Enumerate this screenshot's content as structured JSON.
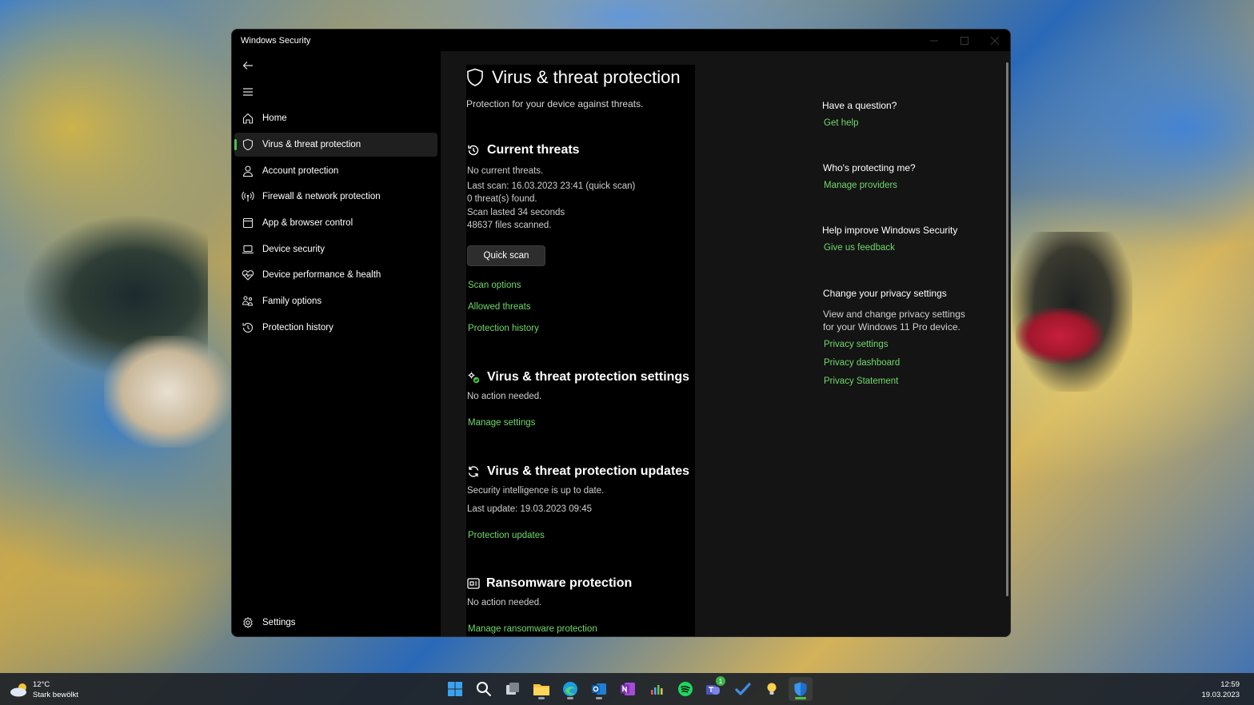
{
  "window": {
    "title": "Windows Security",
    "controls": [
      "minimize-icon",
      "maximize-icon",
      "close-icon"
    ]
  },
  "sidebar": {
    "back_icon": "back-arrow-icon",
    "menu_icon": "hamburger-icon",
    "items": [
      {
        "label": "Home",
        "icon": "home-icon",
        "active": false
      },
      {
        "label": "Virus & threat protection",
        "icon": "shield-icon",
        "active": true
      },
      {
        "label": "Account protection",
        "icon": "person-icon",
        "active": false
      },
      {
        "label": "Firewall & network protection",
        "icon": "antenna-icon",
        "active": false
      },
      {
        "label": "App & browser control",
        "icon": "app-window-icon",
        "active": false
      },
      {
        "label": "Device security",
        "icon": "laptop-icon",
        "active": false
      },
      {
        "label": "Device performance & health",
        "icon": "heart-pulse-icon",
        "active": false
      },
      {
        "label": "Family options",
        "icon": "family-icon",
        "active": false
      },
      {
        "label": "Protection history",
        "icon": "history-icon",
        "active": false
      }
    ],
    "settings_label": "Settings"
  },
  "main": {
    "title": "Virus & threat protection",
    "subtitle": "Protection for your device against threats.",
    "current_threats": {
      "heading": "Current threats",
      "lines": [
        "No current threats.",
        "Last scan: 16.03.2023 23:41 (quick scan)",
        "0 threat(s) found.",
        "Scan lasted 34 seconds",
        "48637 files scanned."
      ],
      "button": "Quick scan",
      "links": [
        "Scan options",
        "Allowed threats",
        "Protection history"
      ]
    },
    "settings_section": {
      "heading": "Virus & threat protection settings",
      "status": "No action needed.",
      "link": "Manage settings"
    },
    "updates_section": {
      "heading": "Virus & threat protection updates",
      "status": "Security intelligence is up to date.",
      "last_update": "Last update: 19.03.2023 09:45",
      "link": "Protection updates"
    },
    "ransomware_section": {
      "heading": "Ransomware protection",
      "status": "No action needed.",
      "link": "Manage ransomware protection"
    }
  },
  "aside": {
    "question": {
      "heading": "Have a question?",
      "link": "Get help"
    },
    "protecting": {
      "heading": "Who's protecting me?",
      "link": "Manage providers"
    },
    "improve": {
      "heading": "Help improve Windows Security",
      "link": "Give us feedback"
    },
    "privacy": {
      "heading": "Change your privacy settings",
      "text_line1": "View and change privacy settings",
      "text_line2": "for your Windows 11 Pro device.",
      "links": [
        "Privacy settings",
        "Privacy dashboard",
        "Privacy Statement"
      ]
    }
  },
  "taskbar": {
    "weather": {
      "temp": "12°C",
      "condition": "Stark bewölkt",
      "icon": "cloud-sun-icon"
    },
    "apps": [
      {
        "name": "start-icon"
      },
      {
        "name": "search-icon"
      },
      {
        "name": "task-view-icon"
      },
      {
        "name": "file-explorer-icon"
      },
      {
        "name": "edge-icon"
      },
      {
        "name": "outlook-icon"
      },
      {
        "name": "onenote-icon"
      },
      {
        "name": "audio-app-icon"
      },
      {
        "name": "spotify-icon"
      },
      {
        "name": "teams-icon",
        "badge": "1"
      },
      {
        "name": "todo-icon"
      },
      {
        "name": "tips-icon"
      },
      {
        "name": "windows-security-icon"
      }
    ],
    "clock": {
      "time": "12:59",
      "date": "19.03.2023"
    }
  },
  "colors": {
    "accent_link": "#70d86a",
    "indicator": "#4cc24a",
    "window_bg": "#000000",
    "content_bg": "#141414"
  }
}
